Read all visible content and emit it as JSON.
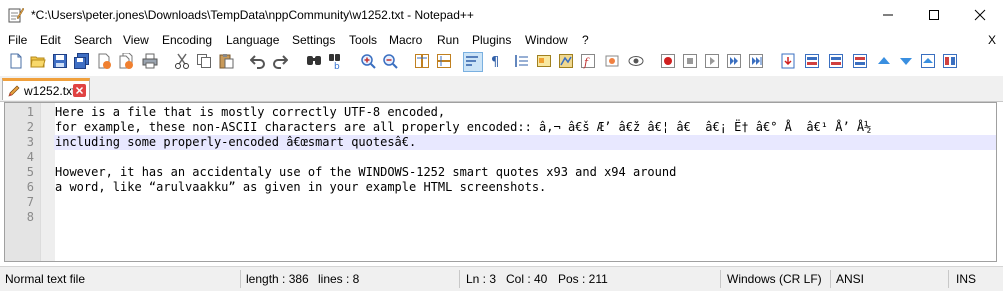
{
  "window": {
    "title": "*C:\\Users\\peter.jones\\Downloads\\TempData\\nppCommunity\\w1252.txt - Notepad++",
    "minimize_icon": "minimize-icon",
    "maximize_icon": "maximize-icon",
    "close_icon": "close-icon"
  },
  "menu": {
    "items": [
      "File",
      "Edit",
      "Search",
      "View",
      "Encoding",
      "Language",
      "Settings",
      "Tools",
      "Macro",
      "Run",
      "Plugins",
      "Window",
      "?"
    ],
    "close_label": "X"
  },
  "toolbar": {
    "icons": [
      "new-file-icon",
      "open-file-icon",
      "save-icon",
      "save-all-icon",
      "close-icon",
      "close-all-icon",
      "print-icon",
      "cut-icon",
      "copy-icon",
      "paste-icon",
      "undo-icon",
      "redo-icon",
      "find-icon",
      "replace-icon",
      "zoom-in-icon",
      "zoom-out-icon",
      "sync-vertical-icon",
      "sync-horizontal-icon",
      "word-wrap-icon",
      "show-all-chars-icon",
      "indent-guide-icon",
      "define-language-icon",
      "doc-map-icon",
      "function-list-icon",
      "folder-workspace-icon",
      "monitoring-icon",
      "record-macro-icon",
      "stop-record-icon",
      "play-macro-icon",
      "play-multiple-icon",
      "save-macro-icon",
      "plugin-a-icon",
      "plugin-b-icon",
      "plugin-c-icon",
      "plugin-d-icon",
      "up-arrow-icon",
      "down-arrow-icon",
      "compare-icon",
      "layout-icon"
    ]
  },
  "tab": {
    "label": "w1252.txt"
  },
  "editor": {
    "lines": [
      {
        "num": "1",
        "text": "Here is a file that is mostly correctly UTF-8 encoded,"
      },
      {
        "num": "2",
        "text": "for example, these non-ASCII characters are all properly encoded:: â‚¬ â€š Æ’ â€ž â€¦ â€  â€¡ Ë† â€° Å  â€¹ Å’ Å½"
      },
      {
        "num": "3",
        "text": "including some properly-encoded â€œsmart quotesâ€."
      },
      {
        "num": "4",
        "text": ""
      },
      {
        "num": "5",
        "text": "However, it has an accidentaly use of the WINDOWS-1252 smart quotes x93 and x94 around"
      },
      {
        "num": "6",
        "text": "a word, like “arulvaakku” as given in your example HTML screenshots."
      },
      {
        "num": "7",
        "text": ""
      },
      {
        "num": "8",
        "text": ""
      }
    ],
    "current_line": 3
  },
  "status": {
    "file_type": "Normal text file",
    "length": "length : 386",
    "lines": "lines : 8",
    "ln": "Ln : 3",
    "col": "Col : 40",
    "pos": "Pos : 211",
    "eol": "Windows (CR LF)",
    "encoding": "ANSI",
    "mode": "INS"
  },
  "colors": {
    "current_line": "#e8e8ff",
    "gutter": "#e4e4e4",
    "tab_accent": "#f0a03c",
    "tab_close": "#e04343"
  }
}
